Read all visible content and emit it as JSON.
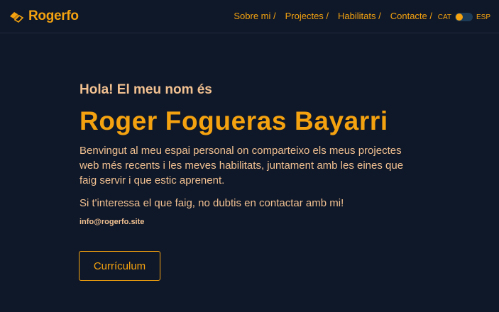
{
  "brand": {
    "name": "Rogerfo",
    "accent": "#f4a20f",
    "text_color": "#f2c191",
    "background": "#0f1829"
  },
  "nav": {
    "items": [
      {
        "label": "Sobre mi /"
      },
      {
        "label": "Projectes /"
      },
      {
        "label": "Habilitats /"
      },
      {
        "label": "Contacte /"
      }
    ]
  },
  "language": {
    "left_label": "CAT",
    "right_label": "ESP",
    "selected": "CAT"
  },
  "hero": {
    "greeting": "Hola! El meu nom és",
    "name": "Roger Fogueras Bayarri",
    "intro": "Benvingut al meu espai personal on comparteixo els meus projectes web més recents i les meves habilitats, juntament amb les eines que faig servir i que estic aprenent.",
    "cta": "Si t'interessa el que faig, no dubtis en contactar amb mi!",
    "email": "info@rogerfo.site",
    "button_label": "Currículum"
  }
}
